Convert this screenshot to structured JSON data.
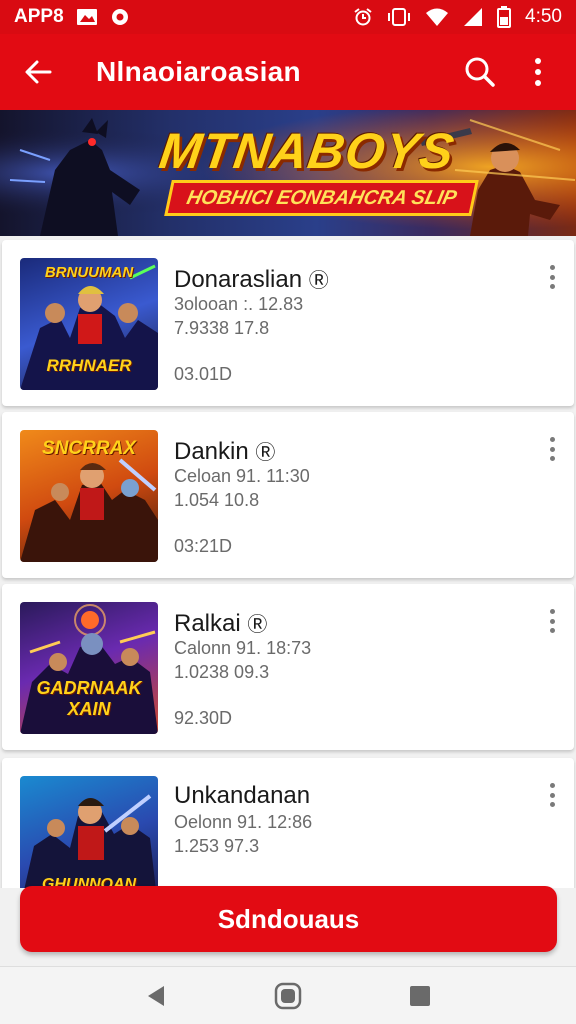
{
  "status_bar": {
    "app_label": "APP8",
    "time": "4:50",
    "icons": [
      "photo-icon",
      "location-icon",
      "alarm-icon",
      "vibrate-icon",
      "wifi-icon",
      "signal-icon",
      "battery-icon"
    ]
  },
  "app_bar": {
    "title": "Nlnaoiaroasian",
    "back_icon": "back-arrow-icon",
    "search_icon": "search-icon",
    "menu_icon": "overflow-menu-icon"
  },
  "banner": {
    "headline": "MTNABOYS",
    "subheadline": "HOBHICI EONBAHCRA SLIP"
  },
  "items": [
    {
      "name": "Donaraslian",
      "line1": "3olooan :. 12.83",
      "line2": "7.9338 17.8",
      "line3": "03.01D",
      "thumb_title": "BRNUUMAN",
      "thumb_caption": "RRHNAER"
    },
    {
      "name": "Dankin",
      "line1": "Celoan 91. 11:30",
      "line2": "1.054 10.8",
      "line3": "03:21D",
      "thumb_title": "SNCRRAX",
      "thumb_caption": ""
    },
    {
      "name": "Ralkai",
      "line1": "Calonn 91. 18:73",
      "line2": "1.0238 09.3",
      "line3": "92.30D",
      "thumb_title": "",
      "thumb_caption": "GADRNAAK XAIN"
    },
    {
      "name": "Unkandanan",
      "line1": "Oelonn 91. 12:86",
      "line2": "1.253 97.3",
      "line3": "",
      "thumb_title": "",
      "thumb_caption": "GHUNNOAN"
    }
  ],
  "primary_button": {
    "label": "Sdndouaus"
  },
  "nav_bar": {
    "back": "nav-back-icon",
    "home": "nav-home-icon",
    "recents": "nav-recents-icon"
  },
  "colors": {
    "brand_red": "#e20b13",
    "status_red": "#d90b12",
    "banner_yellow": "#ffd21a"
  }
}
